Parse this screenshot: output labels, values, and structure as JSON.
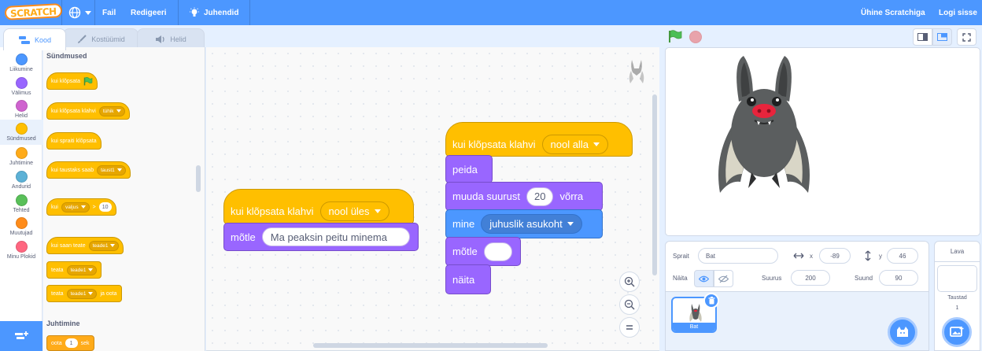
{
  "menubar": {
    "logo": "SCRATCH",
    "file": "Fail",
    "edit": "Redigeeri",
    "tutorials": "Juhendid",
    "join": "Ühine Scratchiga",
    "signin": "Logi sisse",
    "icons": [
      "globe-icon",
      "lightbulb-icon"
    ]
  },
  "tabs": [
    {
      "label": "Kood",
      "icon": "code-icon",
      "active": true
    },
    {
      "label": "Kostüümid",
      "icon": "brush-icon",
      "active": false
    },
    {
      "label": "Helid",
      "icon": "speaker-icon",
      "active": false
    }
  ],
  "categories": [
    {
      "label": "Liikumine",
      "color": "#4c97ff"
    },
    {
      "label": "Välimus",
      "color": "#9966ff"
    },
    {
      "label": "Helid",
      "color": "#cf63cf"
    },
    {
      "label": "Sündmused",
      "color": "#ffbf00"
    },
    {
      "label": "Juhtimine",
      "color": "#ffab19"
    },
    {
      "label": "Andurid",
      "color": "#5cb1d6"
    },
    {
      "label": "Tehted",
      "color": "#59c059"
    },
    {
      "label": "Muutujad",
      "color": "#ff8c1a"
    },
    {
      "label": "Minu Plokid",
      "color": "#ff6680"
    }
  ],
  "palette": {
    "events_title": "Sündmused",
    "control_title": "Juhtimine",
    "when_flag": "kui klõpsata",
    "when_key": "kui klõpsata klahvi",
    "when_key_value": "tühik",
    "when_sprite_clicked": "kui spraiti klõpsata",
    "when_backdrop": "kui taustaks saab",
    "when_backdrop_value": "taust1",
    "when_greater_prefix": "kui",
    "when_greater_value": "valjus",
    "when_greater_op": ">",
    "when_greater_num": "10",
    "when_receive": "kui saan teate",
    "when_receive_value": "teade1",
    "broadcast": "teata",
    "broadcast_value": "teade1",
    "broadcast_wait": "teata",
    "broadcast_wait_value": "teade1",
    "broadcast_wait_suffix": "ja oota",
    "wait": "oota",
    "wait_num": "1",
    "wait_suffix": "sek"
  },
  "script1": {
    "hat": "kui klõpsata klahvi",
    "key": "nool üles",
    "think": "mõtle",
    "think_text": "Ma peaksin peitu minema"
  },
  "script2": {
    "hat": "kui klõpsata klahvi",
    "key": "nool alla",
    "hide": "peida",
    "change_size": "muuda suurust",
    "change_size_num": "20",
    "change_size_suffix": "võrra",
    "goto": "mine",
    "goto_value": "juhuslik asukoht",
    "think": "mõtle",
    "think_text": "",
    "show": "näita"
  },
  "sprite": {
    "sprite_label": "Sprait",
    "name": "Bat",
    "x_label": "x",
    "x": "-89",
    "y_label": "y",
    "y": "46",
    "show_label": "Näita",
    "size_label": "Suurus",
    "size": "200",
    "direction_label": "Suund",
    "direction": "90",
    "thumb_name": "Bat"
  },
  "stage_panel": {
    "title": "Lava",
    "backdrops_label": "Taustad",
    "backdrops_count": "1"
  },
  "colors": {
    "accent": "#4c97ff",
    "events": "#ffbf00",
    "looks": "#9966ff",
    "motion": "#4c97ff",
    "flag": "#4cbf56",
    "stop": "#ec5959"
  }
}
